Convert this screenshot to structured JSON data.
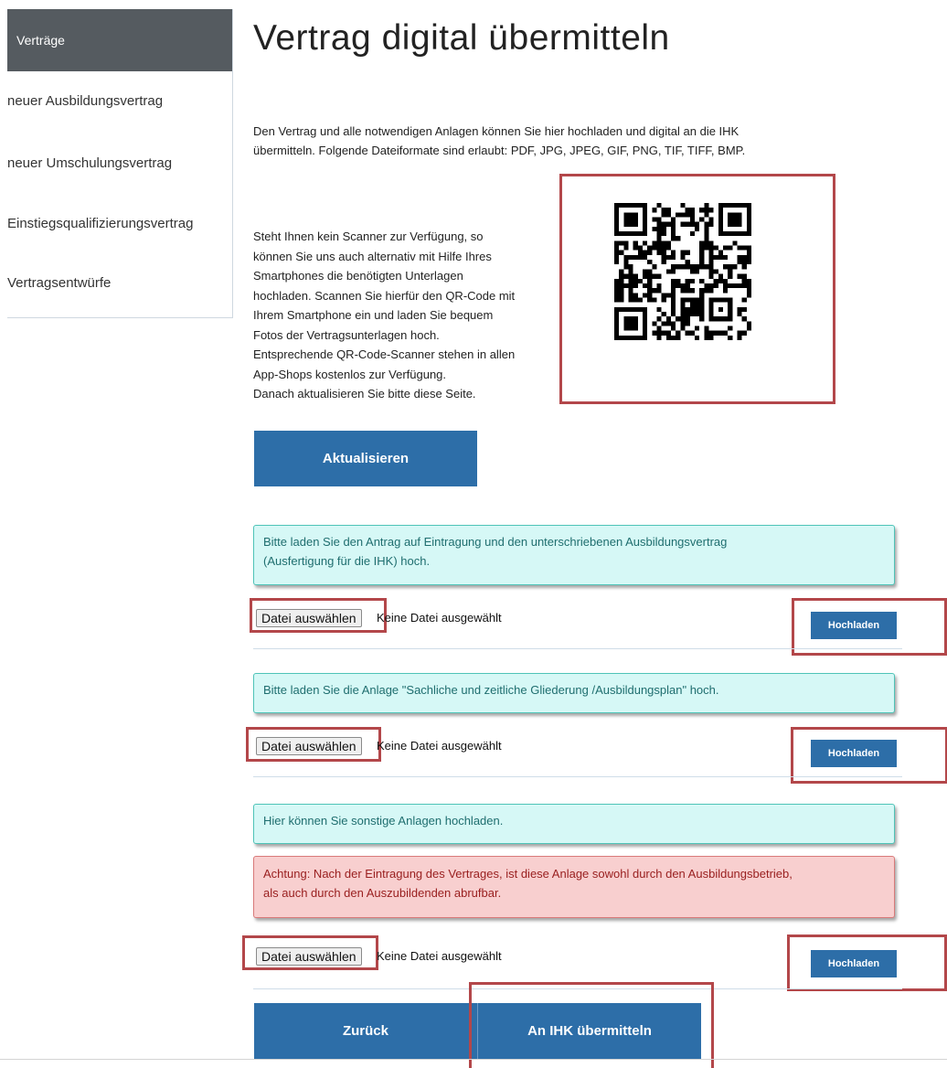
{
  "sidebar": {
    "items": [
      {
        "label": "Verträge",
        "active": true
      },
      {
        "label": "neuer Ausbildungsvertrag"
      },
      {
        "label": "neuer Umschulungsvertrag"
      },
      {
        "label": "Einstiegsqualifizierungsvertrag"
      },
      {
        "label": "Vertragsentwürfe"
      }
    ]
  },
  "main": {
    "title": "Vertrag digital übermitteln",
    "intro_line1": "Den Vertrag und alle notwendigen Anlagen können Sie hier hochladen und digital an die IHK",
    "intro_line2": "übermitteln. Folgende Dateiformate sind erlaubt: PDF, JPG, JPEG, GIF, PNG, TIF, TIFF, BMP.",
    "scan_lines": [
      "Steht Ihnen kein Scanner zur Verfügung, so",
      "können Sie uns auch alternativ mit Hilfe Ihres",
      "Smartphones die benötigten Unterlagen",
      "hochladen. Scannen Sie hierfür den QR-Code mit",
      "Ihrem Smartphone ein und laden Sie bequem",
      "Fotos der Vertragsunterlagen hoch.",
      "Entsprechende QR-Code-Scanner stehen in allen",
      "App-Shops kostenlos zur Verfügung.",
      "Danach aktualisieren Sie bitte diese Seite."
    ],
    "refresh_label": "Aktualisieren",
    "upload_sections": [
      {
        "info_line1": "Bitte laden Sie den Antrag auf Eintragung und den unterschriebenen Ausbildungsvertrag",
        "info_line2": "(Ausfertigung für die IHK) hoch.",
        "choose_label": "Datei auswählen",
        "status": "Keine Datei ausgewählt",
        "upload_label": "Hochladen"
      },
      {
        "info_line1": "Bitte laden Sie die Anlage \"Sachliche und zeitliche Gliederung /Ausbildungsplan\" hoch.",
        "choose_label": "Datei auswählen",
        "status": "Keine Datei ausgewählt",
        "upload_label": "Hochladen"
      },
      {
        "info_line1": "Hier können Sie sonstige Anlagen hochladen.",
        "warning_line1": "Achtung: Nach der Eintragung des Vertrages, ist diese Anlage sowohl durch den Ausbildungsbetrieb,",
        "warning_line2": "als auch durch den Auszubildenden abrufbar.",
        "choose_label": "Datei auswählen",
        "status": "Keine Datei ausgewählt",
        "upload_label": "Hochladen"
      }
    ],
    "back_label": "Zurück",
    "submit_label": "An IHK übermitteln"
  },
  "colors": {
    "primary": "#2d6ea8",
    "sidebar_active": "#555b60",
    "info_bg": "#d6f8f6",
    "info_text": "#1f6e6f",
    "warning_bg": "#f8cfcf",
    "warning_text": "#9a2020",
    "highlight_frame": "#b3474a"
  },
  "icons": {
    "qr": "qr-code-icon"
  }
}
